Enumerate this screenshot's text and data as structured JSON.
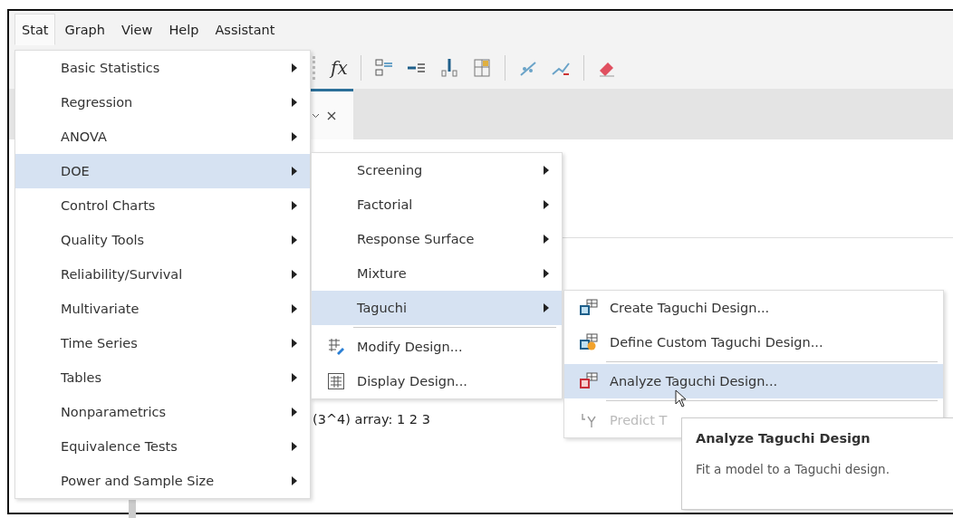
{
  "menubar": [
    {
      "label": "Stat",
      "selected": true
    },
    {
      "label": "Graph",
      "selected": false
    },
    {
      "label": "View",
      "selected": false
    },
    {
      "label": "Help",
      "selected": false
    },
    {
      "label": "Assistant",
      "selected": false
    }
  ],
  "toolbar": {
    "formula_label": "fx"
  },
  "content": {
    "text": "(3^4) array: 1 2 3"
  },
  "stat_menu": [
    {
      "label": "Basic Statistics",
      "selected": false,
      "submenu": true
    },
    {
      "label": "Regression",
      "selected": false,
      "submenu": true
    },
    {
      "label": "ANOVA",
      "selected": false,
      "submenu": true
    },
    {
      "label": "DOE",
      "selected": true,
      "submenu": true
    },
    {
      "label": "Control Charts",
      "selected": false,
      "submenu": true
    },
    {
      "label": "Quality Tools",
      "selected": false,
      "submenu": true
    },
    {
      "label": "Reliability/Survival",
      "selected": false,
      "submenu": true
    },
    {
      "label": "Multivariate",
      "selected": false,
      "submenu": true
    },
    {
      "label": "Time Series",
      "selected": false,
      "submenu": true
    },
    {
      "label": "Tables",
      "selected": false,
      "submenu": true
    },
    {
      "label": "Nonparametrics",
      "selected": false,
      "submenu": true
    },
    {
      "label": "Equivalence Tests",
      "selected": false,
      "submenu": true
    },
    {
      "label": "Power and Sample Size",
      "selected": false,
      "submenu": true
    }
  ],
  "doe_menu": [
    {
      "kind": "submenu",
      "label": "Screening",
      "selected": false
    },
    {
      "kind": "submenu",
      "label": "Factorial",
      "selected": false
    },
    {
      "kind": "submenu",
      "label": "Response Surface",
      "selected": false
    },
    {
      "kind": "submenu",
      "label": "Mixture",
      "selected": false
    },
    {
      "kind": "submenu",
      "label": "Taguchi",
      "selected": true
    },
    {
      "kind": "separator"
    },
    {
      "kind": "modify",
      "label": "Modify Design...",
      "selected": false
    },
    {
      "kind": "display",
      "label": "Display Design...",
      "selected": false
    }
  ],
  "taguchi_menu": [
    {
      "kind": "create",
      "label": "Create Taguchi Design...",
      "selected": false,
      "disabled": false
    },
    {
      "kind": "custom",
      "label": "Define Custom Taguchi Design...",
      "selected": false,
      "disabled": false
    },
    {
      "kind": "separator"
    },
    {
      "kind": "analyze",
      "label": "Analyze Taguchi Design...",
      "selected": true,
      "disabled": false
    },
    {
      "kind": "separator"
    },
    {
      "kind": "predict",
      "label": "Predict T",
      "selected": false,
      "disabled": true
    }
  ],
  "tooltip": {
    "title": "Analyze Taguchi Design",
    "description": "Fit a model to a Taguchi design."
  }
}
